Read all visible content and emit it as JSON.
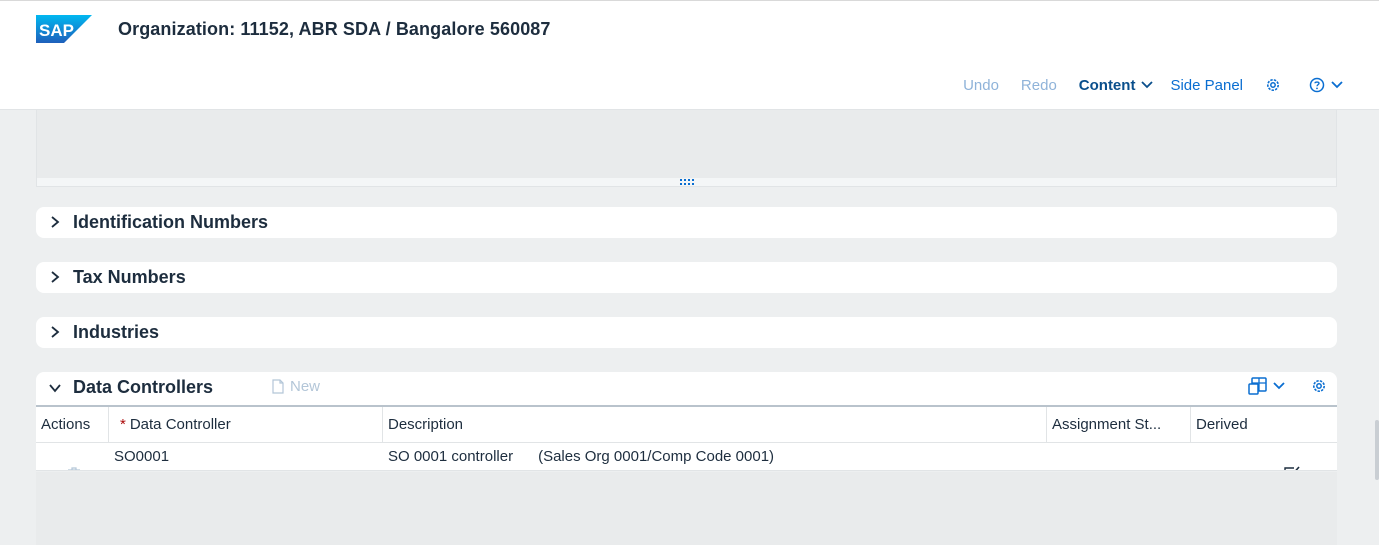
{
  "header": {
    "logo_text": "SAP",
    "title": "Organization: 11152, ABR SDA / Bangalore 560087"
  },
  "toolbar": {
    "undo": "Undo",
    "redo": "Redo",
    "content": "Content",
    "side_panel": "Side Panel"
  },
  "sections": [
    {
      "title": "Identification Numbers"
    },
    {
      "title": "Tax Numbers"
    },
    {
      "title": "Industries"
    }
  ],
  "data_controllers": {
    "title": "Data Controllers",
    "new_label": "New",
    "columns": {
      "actions": "Actions",
      "required_mark": "*",
      "data_controller": "Data Controller",
      "description": "Description",
      "assignment_status": "Assignment St...",
      "derived": "Derived"
    },
    "rows": [
      {
        "data_controller": "SO0001",
        "description": "SO 0001 controller      (Sales Org 0001/Comp Code 0001)",
        "assignment_status": "",
        "derived": true
      }
    ]
  },
  "colors": {
    "brand_blue": "#0a6ed1",
    "shell_bg": "#ffffff",
    "page_bg": "#edeff0",
    "required_red": "#aa0808"
  }
}
